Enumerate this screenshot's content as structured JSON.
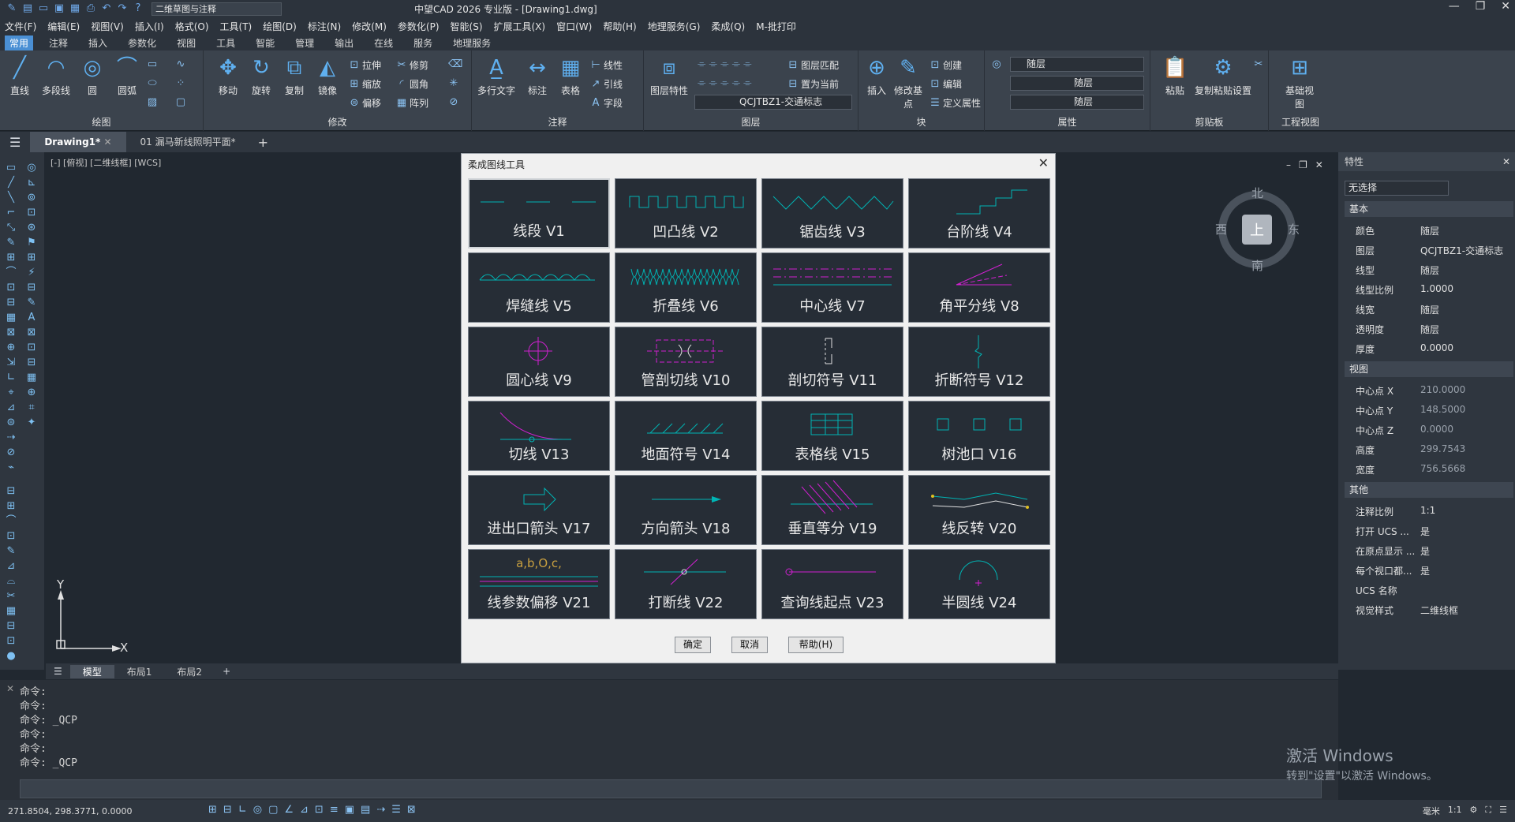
{
  "titlebar": {
    "workspace": "二维草图与注释",
    "app_title": "中望CAD 2026 专业版 - [Drawing1.dwg]"
  },
  "menu": [
    "文件(F)",
    "编辑(E)",
    "视图(V)",
    "插入(I)",
    "格式(O)",
    "工具(T)",
    "绘图(D)",
    "标注(N)",
    "修改(M)",
    "参数化(P)",
    "智能(S)",
    "扩展工具(X)",
    "窗口(W)",
    "帮助(H)",
    "地理服务(G)",
    "柔成(Q)",
    "M-批打印"
  ],
  "ribbon_tabs": [
    "常用",
    "注释",
    "插入",
    "参数化",
    "视图",
    "工具",
    "智能",
    "管理",
    "输出",
    "在线",
    "服务",
    "地理服务"
  ],
  "ribbon": {
    "draw": {
      "label": "绘图",
      "line": "直线",
      "pline": "多段线",
      "circle": "圆",
      "arc": "圆弧"
    },
    "modify": {
      "label": "修改",
      "move": "移动",
      "rotate": "旋转",
      "copy": "复制",
      "mirror": "镜像",
      "stretch": "拉伸",
      "scale": "缩放",
      "offset": "偏移",
      "trim": "修剪",
      "fillet": "圆角",
      "array": "阵列"
    },
    "annot": {
      "label": "注释",
      "mtext": "多行文字",
      "dim": "标注",
      "table": "表格",
      "linear": "线性",
      "leader": "引线",
      "field": "字段"
    },
    "layers": {
      "label": "图层",
      "props": "图层特性",
      "match": "图层匹配",
      "setcur": "置为当前",
      "current": "QCJTBZ1-交通标志"
    },
    "block": {
      "label": "块",
      "insert": "插入",
      "edit_base": "修改基点",
      "create": "创建",
      "edit": "编辑",
      "define": "定义属性"
    },
    "props": {
      "label": "属性",
      "color": "随层",
      "ltype": "随层",
      "lweight": "随层"
    },
    "clip": {
      "label": "剪贴板",
      "paste": "粘贴",
      "copyset": "复制粘贴设置"
    },
    "eng": {
      "label": "工程视图",
      "base": "基础视图"
    }
  },
  "doc_tabs": [
    "Drawing1*",
    "01 漏马新线照明平面*"
  ],
  "viewport_label": "[-] [俯视] [二维线框] [WCS]",
  "viewcube": {
    "n": "北",
    "s": "南",
    "e": "东",
    "w": "西",
    "top": "上"
  },
  "ucs": {
    "x": "X",
    "y": "Y"
  },
  "dialog": {
    "title": "柔成图线工具",
    "items": [
      "线段 V1",
      "凹凸线 V2",
      "锯齿线 V3",
      "台阶线 V4",
      "焊缝线 V5",
      "折叠线 V6",
      "中心线 V7",
      "角平分线 V8",
      "圆心线 V9",
      "管剖切线 V10",
      "剖切符号 V11",
      "折断符号 V12",
      "切线 V13",
      "地面符号 V14",
      "表格线 V15",
      "树池口 V16",
      "进出口箭头 V17",
      "方向箭头 V18",
      "垂直等分 V19",
      "线反转 V20",
      "线参数偏移 V21",
      "打断线 V22",
      "查询线起点 V23",
      "半圆线 V24"
    ],
    "ok": "确定",
    "cancel": "取消",
    "help": "帮助(H)",
    "sample_text": "a,b,O,c,"
  },
  "properties": {
    "header": "特性",
    "selection": "无选择",
    "sec_basic": "基本",
    "basic": [
      [
        "颜色",
        "随层"
      ],
      [
        "图层",
        "QCJTBZ1-交通标志"
      ],
      [
        "线型",
        "随层"
      ],
      [
        "线型比例",
        "1.0000"
      ],
      [
        "线宽",
        "随层"
      ],
      [
        "透明度",
        "随层"
      ],
      [
        "厚度",
        "0.0000"
      ]
    ],
    "sec_view": "视图",
    "view": [
      [
        "中心点 X",
        "210.0000"
      ],
      [
        "中心点 Y",
        "148.5000"
      ],
      [
        "中心点 Z",
        "0.0000"
      ],
      [
        "高度",
        "299.7543"
      ],
      [
        "宽度",
        "756.5668"
      ]
    ],
    "sec_misc": "其他",
    "misc": [
      [
        "注释比例",
        "1:1"
      ],
      [
        "打开 UCS ...",
        "是"
      ],
      [
        "在原点显示 ...",
        "是"
      ],
      [
        "每个视口都...",
        "是"
      ],
      [
        "UCS 名称",
        ""
      ],
      [
        "视觉样式",
        "二维线框"
      ]
    ]
  },
  "layout_tabs": [
    "模型",
    "布局1",
    "布局2"
  ],
  "command": {
    "lines": [
      "命令:",
      "命令:",
      "命令: _QCP",
      "命令:",
      "命令:",
      "命令: _QCP"
    ]
  },
  "status": {
    "coords": "271.8504, 298.3771, 0.0000",
    "unit": "毫米",
    "scale": "1:1"
  },
  "watermark": {
    "line1": "激活 Windows",
    "line2": "转到\"设置\"以激活 Windows。"
  },
  "colors": {
    "cyan": "#00b4b4",
    "magenta": "#d020d0",
    "white": "#e0e0e0",
    "accent": "#4a8fd4"
  }
}
